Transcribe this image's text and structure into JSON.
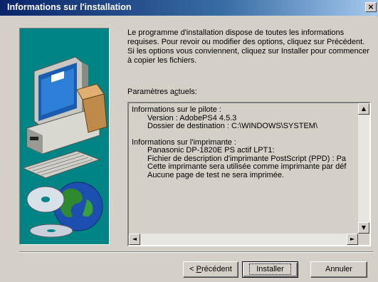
{
  "window": {
    "title": "Informations sur l'installation",
    "close_glyph": "×"
  },
  "intro_text": "Le programme d'installation dispose de toutes les informations requises. Pour revoir ou modifier des options, cliquez sur Précédent. Si les options vous conviennent, cliquez sur Installer pour commencer à copier les fichiers.",
  "params": {
    "label_pre": "Paramètres a",
    "label_key": "c",
    "label_post": "tuels:",
    "lines": {
      "driver_header": "Informations sur le pilote :",
      "version": "Version : AdobePS4 4.5.3",
      "destination": "Dossier de destination : C:\\WINDOWS\\SYSTEM\\",
      "printer_header": "Informations sur l'imprimante :",
      "printer_name": "Panasonic DP-1820E PS actif LPT1:",
      "ppd": "Fichier de description d'imprimante PostScript (PPD) : Pa",
      "default_printer": "Cette imprimante sera utilisée comme imprimante par déf",
      "test_page": "Aucune page de test ne sera imprimée."
    }
  },
  "buttons": {
    "back_pre": "< ",
    "back_key": "P",
    "back_post": "récédent",
    "install": "Installer",
    "cancel": "Annuler"
  },
  "icons": {
    "scroll_up": "▲",
    "scroll_down": "▼",
    "scroll_left": "◄",
    "scroll_right": "►"
  }
}
